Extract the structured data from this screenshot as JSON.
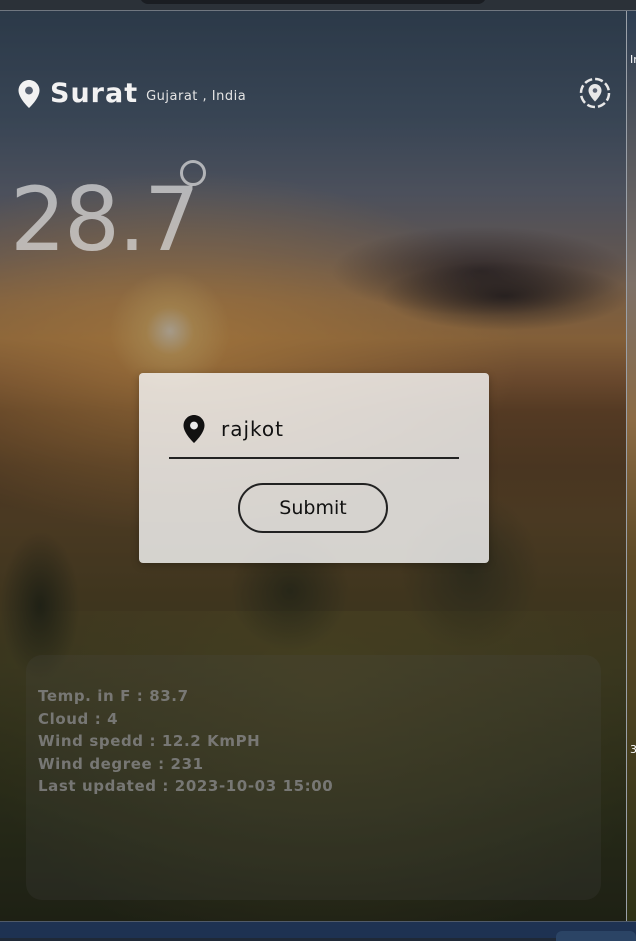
{
  "header": {
    "city": "Surat",
    "region": "Gujarat , India",
    "locate_icon": "crosshair-location-icon"
  },
  "weather": {
    "temperature": "28.7"
  },
  "search": {
    "value": "rajkot",
    "submit_label": "Submit",
    "pin_icon": "map-pin-icon"
  },
  "details": [
    "Temp. in F : 83.7",
    "Cloud : 4",
    "Wind spedd : 12.2 KmPH",
    "Wind degree : 231",
    "Last updated : 2023-10-03 15:00"
  ],
  "side_window": {
    "frag_top": "In",
    "frag_bottom": "3"
  }
}
